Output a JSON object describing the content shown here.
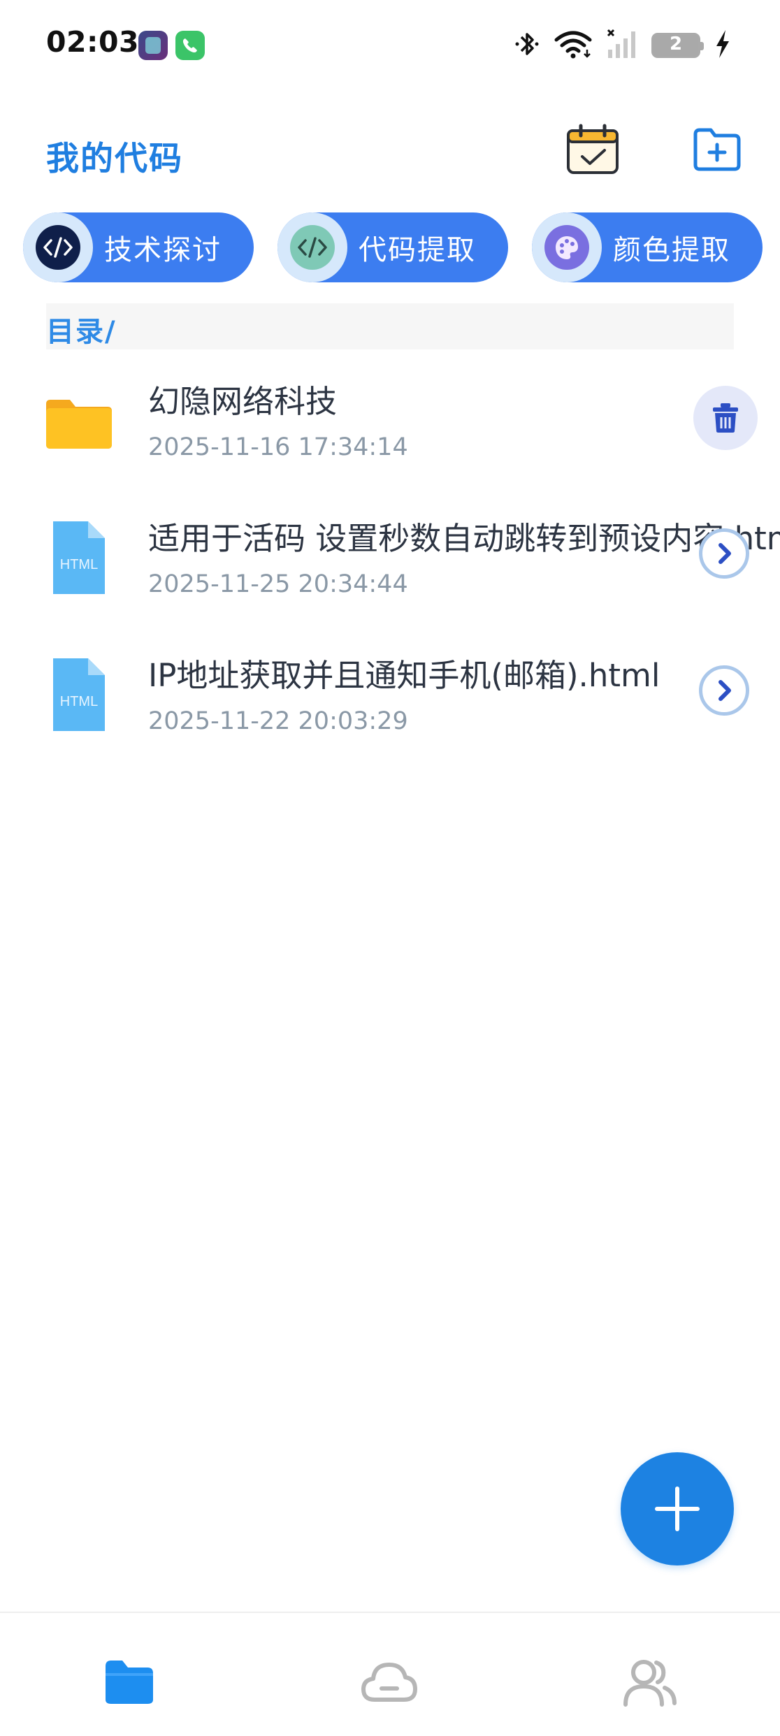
{
  "status_bar": {
    "time": "02:03",
    "battery_level": "2",
    "icons": [
      "bluetooth-icon",
      "wifi-icon",
      "signal-icon",
      "battery-icon",
      "charging-icon"
    ]
  },
  "header": {
    "title": "我的代码",
    "calendar_icon": "calendar-check-icon",
    "new_folder_icon": "folder-plus-icon"
  },
  "chips": [
    {
      "label": "技术探讨",
      "icon": "code-icon"
    },
    {
      "label": "代码提取",
      "icon": "code-extract-icon"
    },
    {
      "label": "颜色提取",
      "icon": "palette-icon"
    }
  ],
  "path": {
    "label": "目录/"
  },
  "files": [
    {
      "name": "幻隐网络科技",
      "time": "2025-11-16 17:34:14",
      "type": "folder",
      "action": "delete"
    },
    {
      "name": "适用于活码 设置秒数自动跳转到预设内容.html",
      "time": "2025-11-25 20:34:44",
      "type": "html",
      "type_label": "HTML",
      "action": "open"
    },
    {
      "name": "IP地址获取并且通知手机(邮箱).html",
      "time": "2025-11-22 20:03:29",
      "type": "html",
      "type_label": "HTML",
      "action": "open"
    }
  ],
  "fab": {
    "icon": "plus-icon"
  },
  "bottom_nav": [
    {
      "id": "files",
      "icon": "folder-icon",
      "active": true
    },
    {
      "id": "cloud",
      "icon": "cloud-icon",
      "active": false
    },
    {
      "id": "user",
      "icon": "users-icon",
      "active": false
    }
  ],
  "colors": {
    "accent": "#1d82e2",
    "chip_bg": "#3c7df0",
    "title": "#1f7ee0",
    "folder": "#fec223",
    "html_file": "#5ab8f5",
    "muted_text": "#8a98a6"
  }
}
